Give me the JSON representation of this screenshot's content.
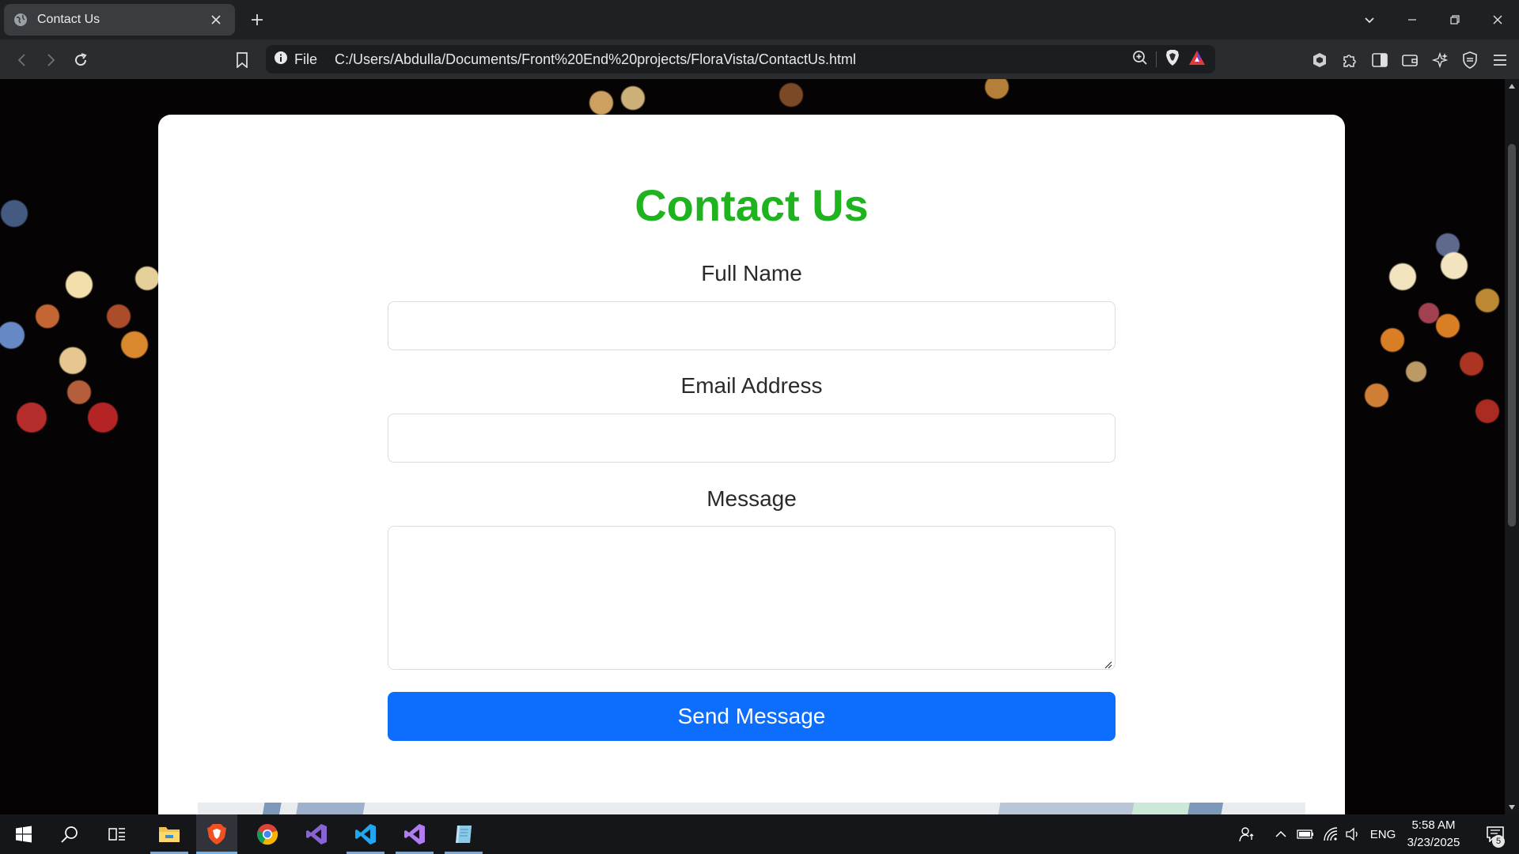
{
  "browser": {
    "tab": {
      "title": "Contact Us"
    },
    "address_bar": {
      "scheme_label": "File",
      "url": "C:/Users/Abdulla/Documents/Front%20End%20projects/FloraVista/ContactUs.html"
    }
  },
  "page": {
    "heading": "Contact Us",
    "heading_color": "#1fb31f",
    "fields": {
      "full_name": {
        "label": "Full Name",
        "value": ""
      },
      "email": {
        "label": "Email Address",
        "value": ""
      },
      "message": {
        "label": "Message",
        "value": ""
      }
    },
    "send_button": {
      "label": "Send Message",
      "color": "#0d6efd"
    }
  },
  "taskbar": {
    "apps": [
      "start-icon",
      "search-icon",
      "task-view-icon",
      "file-explorer-icon",
      "brave-browser-icon",
      "chrome-icon",
      "visual-studio-icon",
      "vscode-icon",
      "visual-studio-icon",
      "notepad-icon"
    ],
    "tray": {
      "language": "ENG",
      "time": "5:58 AM",
      "date": "3/23/2025",
      "notification_count": "5"
    }
  }
}
